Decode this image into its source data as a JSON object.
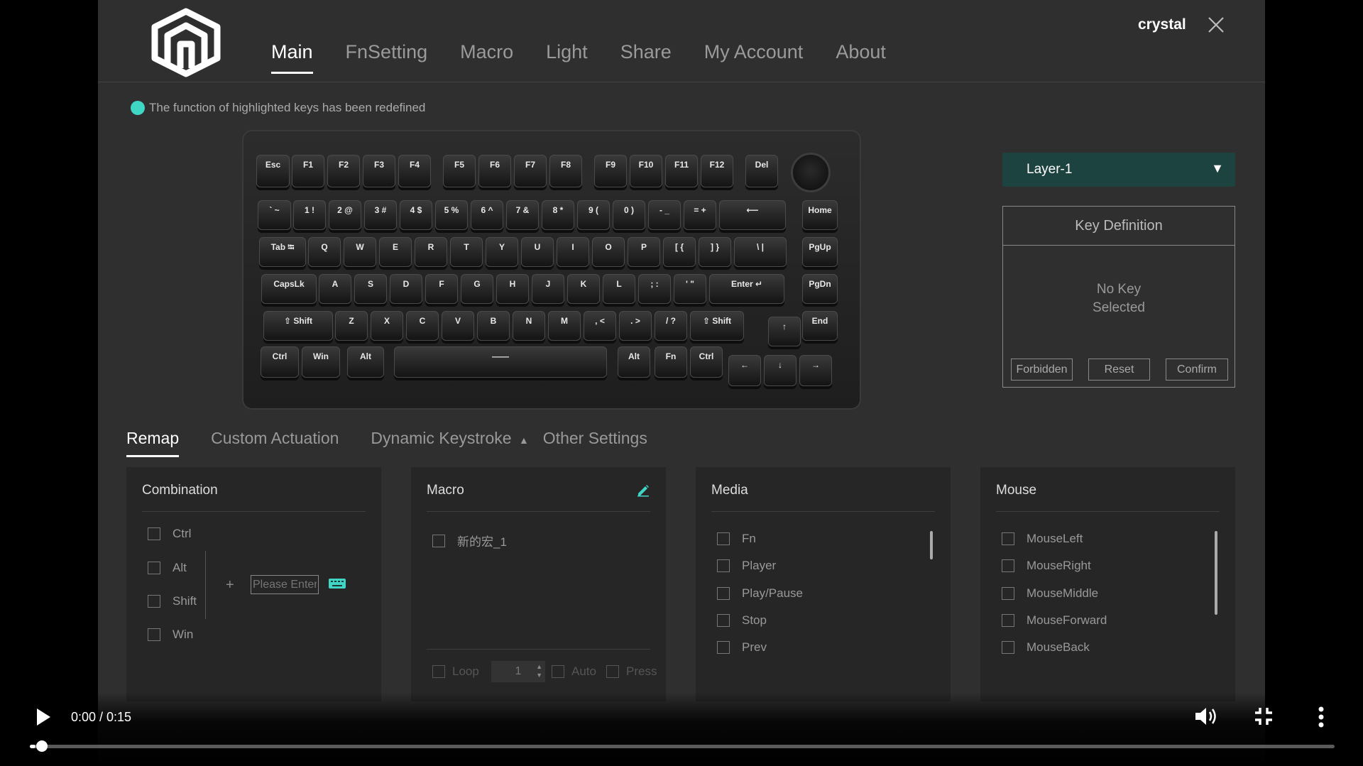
{
  "user": {
    "name": "crystal"
  },
  "nav": {
    "items": [
      "Main",
      "FnSetting",
      "Macro",
      "Light",
      "Share",
      "My Account",
      "About"
    ],
    "active": 0
  },
  "notice": "The function of highlighted keys has been redefined",
  "colors": {
    "accent": "#3fd6c5",
    "background": "#2f2f2f",
    "layer_bg": "#1d4340"
  },
  "keyboard": {
    "row0": [
      "Esc",
      "F1",
      "F2",
      "F3",
      "F4",
      "F5",
      "F6",
      "F7",
      "F8",
      "F9",
      "F10",
      "F11",
      "F12",
      "Del"
    ],
    "row1": [
      "` ~",
      "1 !",
      "2 @",
      "3 #",
      "4 $",
      "5 %",
      "6 ^",
      "7 &",
      "8 *",
      "9 (",
      "0 )",
      "- _",
      "= +",
      "⟵",
      "Home"
    ],
    "row2": [
      "Tab ⭾",
      "Q",
      "W",
      "E",
      "R",
      "T",
      "Y",
      "U",
      "I",
      "O",
      "P",
      "[ {",
      "] }",
      "\\ |",
      "PgUp"
    ],
    "row3": [
      "CapsLk",
      "A",
      "S",
      "D",
      "F",
      "G",
      "H",
      "J",
      "K",
      "L",
      "; :",
      "' \"",
      "Enter ↵",
      "PgDn"
    ],
    "row4": [
      "⇧ Shift",
      "Z",
      "X",
      "C",
      "V",
      "B",
      "N",
      "M",
      ", <",
      ". >",
      "/ ?",
      "⇧ Shift",
      "↑",
      "End"
    ],
    "row5": [
      "Ctrl",
      "Win",
      "Alt",
      "——",
      "Alt",
      "Fn",
      "Ctrl",
      "←",
      "↓",
      "→"
    ]
  },
  "layer": {
    "selected": "Layer-1"
  },
  "key_definition": {
    "title": "Key Definition",
    "empty_line1": "No Key",
    "empty_line2": "Selected",
    "forbidden": "Forbidden",
    "reset": "Reset",
    "confirm": "Confirm"
  },
  "subtabs": {
    "items": [
      "Remap",
      "Custom Actuation",
      "Dynamic Keystroke",
      "Other Settings"
    ],
    "active": 0
  },
  "combination": {
    "title": "Combination",
    "modifiers": [
      "Ctrl",
      "Alt",
      "Shift",
      "Win"
    ],
    "plus": "+",
    "input_placeholder": "Please Enter"
  },
  "macro": {
    "title": "Macro",
    "items": [
      "新的宏_1"
    ],
    "loop_label": "Loop",
    "loop_count": "1",
    "auto_label": "Auto",
    "press_label": "Press"
  },
  "media": {
    "title": "Media",
    "items": [
      "Fn",
      "Player",
      "Play/Pause",
      "Stop",
      "Prev"
    ]
  },
  "mouse": {
    "title": "Mouse",
    "items": [
      "MouseLeft",
      "MouseRight",
      "MouseMiddle",
      "MouseForward",
      "MouseBack"
    ]
  },
  "video": {
    "time": "0:00 / 0:15",
    "progress": 0.003
  }
}
